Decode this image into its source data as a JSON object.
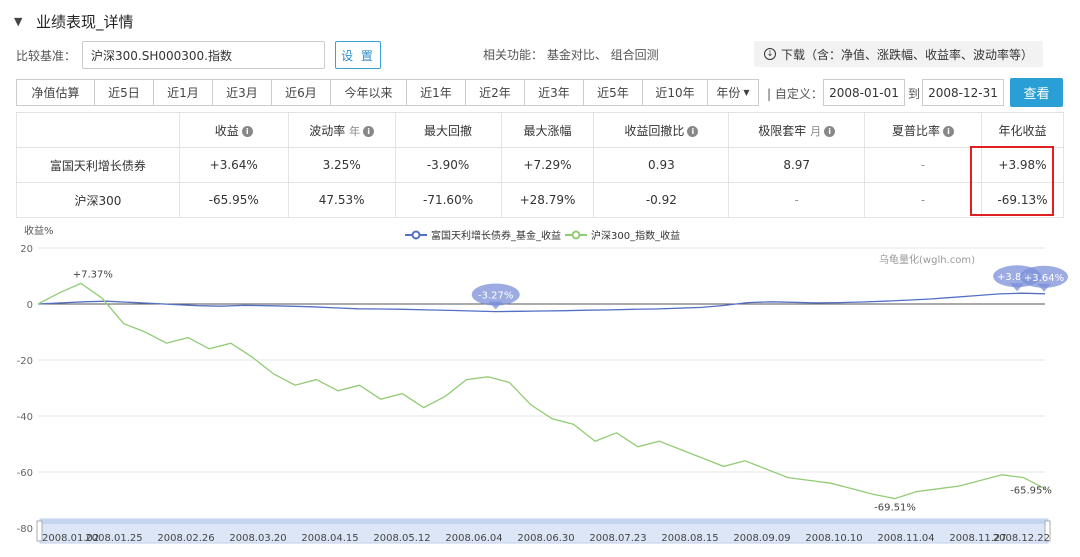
{
  "header": {
    "title": "业绩表现_详情"
  },
  "benchmark": {
    "label": "比较基准：",
    "value": "沪深300.SH000300.指数",
    "setting_button": "设 置"
  },
  "related": {
    "text": "相关功能： 基金对比、 组合回测"
  },
  "download": {
    "label": "下载（含：净值、涨跌幅、收益率、波动率等）"
  },
  "periods": [
    {
      "label": "净值估算"
    },
    {
      "label": "近5日"
    },
    {
      "label": "近1月"
    },
    {
      "label": "近3月"
    },
    {
      "label": "近6月"
    },
    {
      "label": "今年以来"
    },
    {
      "label": "近1年"
    },
    {
      "label": "近2年"
    },
    {
      "label": "近3年"
    },
    {
      "label": "近5年"
    },
    {
      "label": "近10年"
    },
    {
      "label": "年份"
    }
  ],
  "custom": {
    "label": "| 自定义：",
    "start": "2008-01-01",
    "to": "到",
    "end": "2008-12-31",
    "query_button": "查看"
  },
  "table": {
    "headers": [
      "",
      "收益",
      "波动率",
      "最大回撤",
      "最大涨幅",
      "收益回撤比",
      "极限套牢",
      "夏普比率",
      "年化收益"
    ],
    "header_suffix": {
      "vol": "年",
      "trap": "月"
    },
    "rows": [
      {
        "name": "富国天利增长债券",
        "cells": [
          "+3.64%",
          "3.25%",
          "-3.90%",
          "+7.29%",
          "0.93",
          "8.97",
          "-",
          "+3.98%"
        ]
      },
      {
        "name": "沪深300",
        "cells": [
          "-65.95%",
          "47.53%",
          "-71.60%",
          "+28.79%",
          "-0.92",
          "-",
          "-",
          "-69.13%"
        ]
      }
    ]
  },
  "chart_data": {
    "type": "line",
    "ylabel": "收益%",
    "ylim": [
      -80,
      20
    ],
    "yticks": [
      20,
      0,
      -20,
      -40,
      -60,
      -80
    ],
    "grid": true,
    "legend_position": "top-center",
    "watermark": "乌龟量化(wglh.com)",
    "x_ticks": [
      "2008.01.02",
      "2008.01.25",
      "2008.02.26",
      "2008.03.20",
      "2008.04.15",
      "2008.05.12",
      "2008.06.04",
      "2008.06.30",
      "2008.07.23",
      "2008.08.15",
      "2008.09.09",
      "2008.10.10",
      "2008.11.04",
      "2008.11.27",
      "2008.12.22"
    ],
    "series": [
      {
        "name": "富国天利增长债券_基金_收益",
        "color": "#5470c6",
        "values": [
          0,
          0.4,
          0.8,
          1.0,
          0.6,
          0.2,
          -0.2,
          -0.6,
          -0.8,
          -0.5,
          -0.6,
          -0.8,
          -1.0,
          -1.4,
          -1.7,
          -1.8,
          -1.9,
          -2.1,
          -2.3,
          -2.5,
          -2.7,
          -2.6,
          -2.5,
          -2.4,
          -2.2,
          -2.1,
          -1.9,
          -1.8,
          -1.5,
          -1.2,
          -0.5,
          0.5,
          0.8,
          0.6,
          0.4,
          0.5,
          0.7,
          1.0,
          1.4,
          1.8,
          2.4,
          3.0,
          3.6,
          3.84,
          3.64
        ]
      },
      {
        "name": "沪深300_指数_收益",
        "color": "#91cc75",
        "values": [
          0,
          4,
          7.37,
          2,
          -7,
          -10,
          -14,
          -12,
          -16,
          -14,
          -19,
          -25,
          -29,
          -27,
          -31,
          -29,
          -34,
          -32,
          -37,
          -33,
          -27,
          -26,
          -28,
          -36,
          -41,
          -43,
          -49,
          -46,
          -51,
          -49,
          -52,
          -55,
          -58,
          -56,
          -59,
          -62,
          -63,
          -64,
          -66,
          -68,
          -69.51,
          -67,
          -66,
          -65,
          -63,
          -61,
          -62,
          -65.95
        ]
      }
    ],
    "annotations": [
      {
        "label": "+7.37%"
      },
      {
        "label": "-3.27%"
      },
      {
        "label": "+3.84%"
      },
      {
        "label": "+3.64%"
      },
      {
        "label": "-69.51%"
      },
      {
        "label": "-65.95%"
      }
    ]
  }
}
